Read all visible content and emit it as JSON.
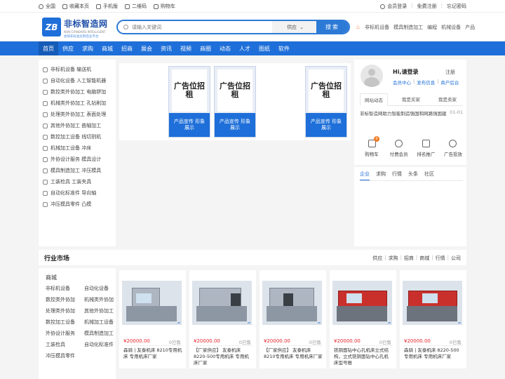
{
  "topbar": {
    "left": [
      {
        "icon": "home-icon",
        "label": "全国"
      },
      {
        "icon": "star-icon",
        "label": "收藏本页"
      },
      {
        "icon": "mobile-icon",
        "label": "手机版"
      },
      {
        "icon": "qrcode-icon",
        "label": "二维码"
      },
      {
        "icon": "cart-icon",
        "label": "购物车"
      }
    ],
    "login": "会员登录",
    "register": "免费注册",
    "forgot": "忘记密码"
  },
  "logo": {
    "mark": "ZB",
    "name": "非标智造网",
    "en": "NON STANDARD INTELLIGENT",
    "slogan": "加快非标准化制造业平台"
  },
  "search": {
    "placeholder": "请输入关键词",
    "category": "供应",
    "button": "搜索"
  },
  "hotwords": [
    "非标机设备",
    "模具制造加工",
    "编程",
    "机械设备",
    "产品"
  ],
  "nav": [
    "首页",
    "供应",
    "求购",
    "商城",
    "招商",
    "展会",
    "资讯",
    "视频",
    "商圈",
    "动态",
    "人才",
    "图纸",
    "软件"
  ],
  "categories": [
    "非标机设备 输送机",
    "自动化设备 人工智能机器",
    "数控类外协加工 电脑锣加",
    "机械类外协加工 孔钻削加",
    "处理类外协加工 表面处理",
    "其他外协加工 曲轴加工",
    "数控加工设备 线切割机",
    "机械加工设备 冲床",
    "外协设计服务 模具设计",
    "模具制造加工 冲压模具",
    "工装检具 工装夹具",
    "自动化标准件 导向轴",
    "冲压模具零件 凸模"
  ],
  "banner": {
    "ad_top": "广告位招租",
    "ad_bottom": "产品宣传 形象展示"
  },
  "user": {
    "greeting": "Hi,请登录",
    "register": "注册",
    "links": [
      "会员中心",
      "发布信息",
      "商户后台"
    ],
    "tabs": [
      "网站动态",
      "我是买家",
      "我是卖家"
    ],
    "news": {
      "title": "非标智造网助力智能制造强国和网路强国建",
      "date": "01-01"
    },
    "icons": [
      {
        "icon": "cart-icon",
        "label": "购物车",
        "badge": "0"
      },
      {
        "icon": "vip-icon",
        "label": "付费会员"
      },
      {
        "icon": "rank-icon",
        "label": "排名推广"
      },
      {
        "icon": "ad-icon",
        "label": "广告投放"
      }
    ]
  },
  "newstabs": [
    "企业",
    "求购",
    "行情",
    "头条",
    "社区"
  ],
  "market": {
    "title": "行业市场",
    "links": [
      "供应",
      "求购",
      "招商",
      "商城",
      "行情",
      "公司"
    ],
    "side_title": "商城",
    "side_items": [
      "非标机设备",
      "自动化设备",
      "数控类外协加",
      "机械类外协加",
      "处理类外协加",
      "其他外协加工",
      "数控加工设备",
      "机械加工设备",
      "外协设计服务",
      "模具制造加工",
      "工装检具",
      "自动化标准件",
      "冲压模具零件"
    ]
  },
  "products": [
    {
      "price": "¥20000.00",
      "sold": "0已售",
      "title": "森骑 | 友泰机床 8210专用机床 专用机床厂家",
      "style": "grey"
    },
    {
      "price": "¥20000.00",
      "sold": "0已售",
      "title": "【厂家供应】 友泰机床 8220-500专用机床 专用机床厂家",
      "style": "grey"
    },
    {
      "price": "¥20000.00",
      "sold": "0已售",
      "title": "【厂家供应】 友泰机床 8210专用机床 专用机床厂家",
      "style": "grey"
    },
    {
      "price": "¥20000.00",
      "sold": "0已售",
      "title": "铣铜面钻中心孔机床立式结构，立式铣铜面钻中心孔机床型号推",
      "style": "red"
    },
    {
      "price": "¥20000.00",
      "sold": "0已售",
      "title": "森骑 | 友泰机床 8220-500专用机床 专用机床厂家",
      "style": "red"
    }
  ]
}
